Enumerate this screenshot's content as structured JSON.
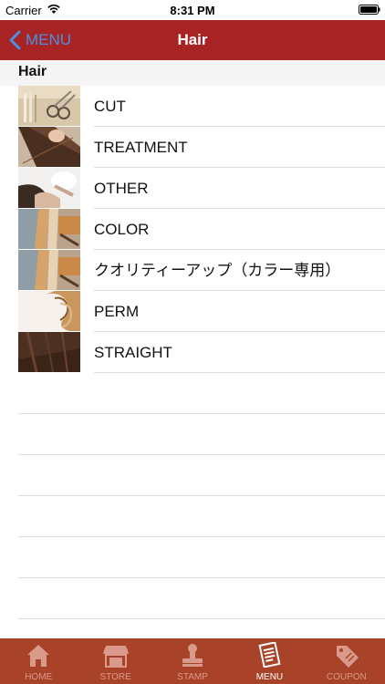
{
  "status_bar": {
    "carrier": "Carrier",
    "time": "8:31 PM"
  },
  "nav": {
    "back_label": "MENU",
    "title": "Hair"
  },
  "section": {
    "title": "Hair"
  },
  "menu_items": [
    {
      "label": "CUT",
      "image": "scissors-photo"
    },
    {
      "label": "TREATMENT",
      "image": "long-hair-photo"
    },
    {
      "label": "OTHER",
      "image": "hair-wash-photo"
    },
    {
      "label": "COLOR",
      "image": "hair-color-photo"
    },
    {
      "label": "クオリティーアップ（カラー専用）",
      "image": "hair-color-photo"
    },
    {
      "label": "PERM",
      "image": "curly-hair-photo"
    },
    {
      "label": "STRAIGHT",
      "image": "straight-hair-photo"
    }
  ],
  "tabs": [
    {
      "label": "HOME",
      "icon": "home-icon",
      "active": false
    },
    {
      "label": "STORE",
      "icon": "store-icon",
      "active": false
    },
    {
      "label": "STAMP",
      "icon": "stamp-icon",
      "active": false
    },
    {
      "label": "MENU",
      "icon": "menu-document-icon",
      "active": true
    },
    {
      "label": "COUPON",
      "icon": "coupon-tag-icon",
      "active": false
    }
  ],
  "colors": {
    "nav_bar": "#a82424",
    "tab_bar": "#a84228",
    "back_link": "#4a90e2",
    "tab_inactive": "#d99a8c",
    "tab_active": "#ffffff"
  }
}
